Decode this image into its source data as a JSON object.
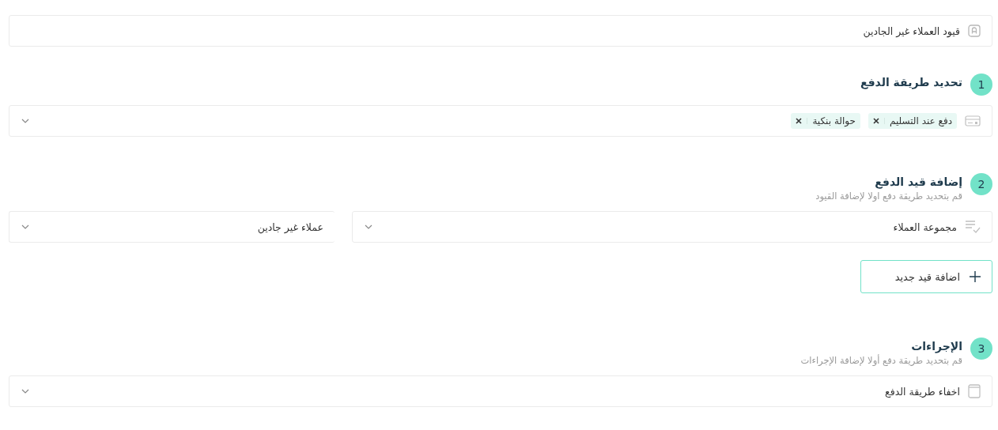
{
  "name_field": {
    "value": "قيود العملاء غير الجادين"
  },
  "sections": [
    {
      "number": "1",
      "title": "تحديد طريقة الدفع",
      "tags": [
        {
          "label": "دفع عند التسليم"
        },
        {
          "label": "حوالة بنكية"
        }
      ]
    },
    {
      "number": "2",
      "title": "إضافة قيد الدفع",
      "subtitle": "قم بتحديد طريقة دفع اولا لإضافة القيود",
      "condition": {
        "field": "مجموعة العملاء",
        "value": "عملاء غير جادين"
      },
      "add_button": "اضافة قيد جديد"
    },
    {
      "number": "3",
      "title": "الإجراءات",
      "subtitle": "قم بتحديد طريقة دفع أولا لإضافة الإجراءات",
      "action": "اخفاء طريقة الدفع"
    }
  ]
}
